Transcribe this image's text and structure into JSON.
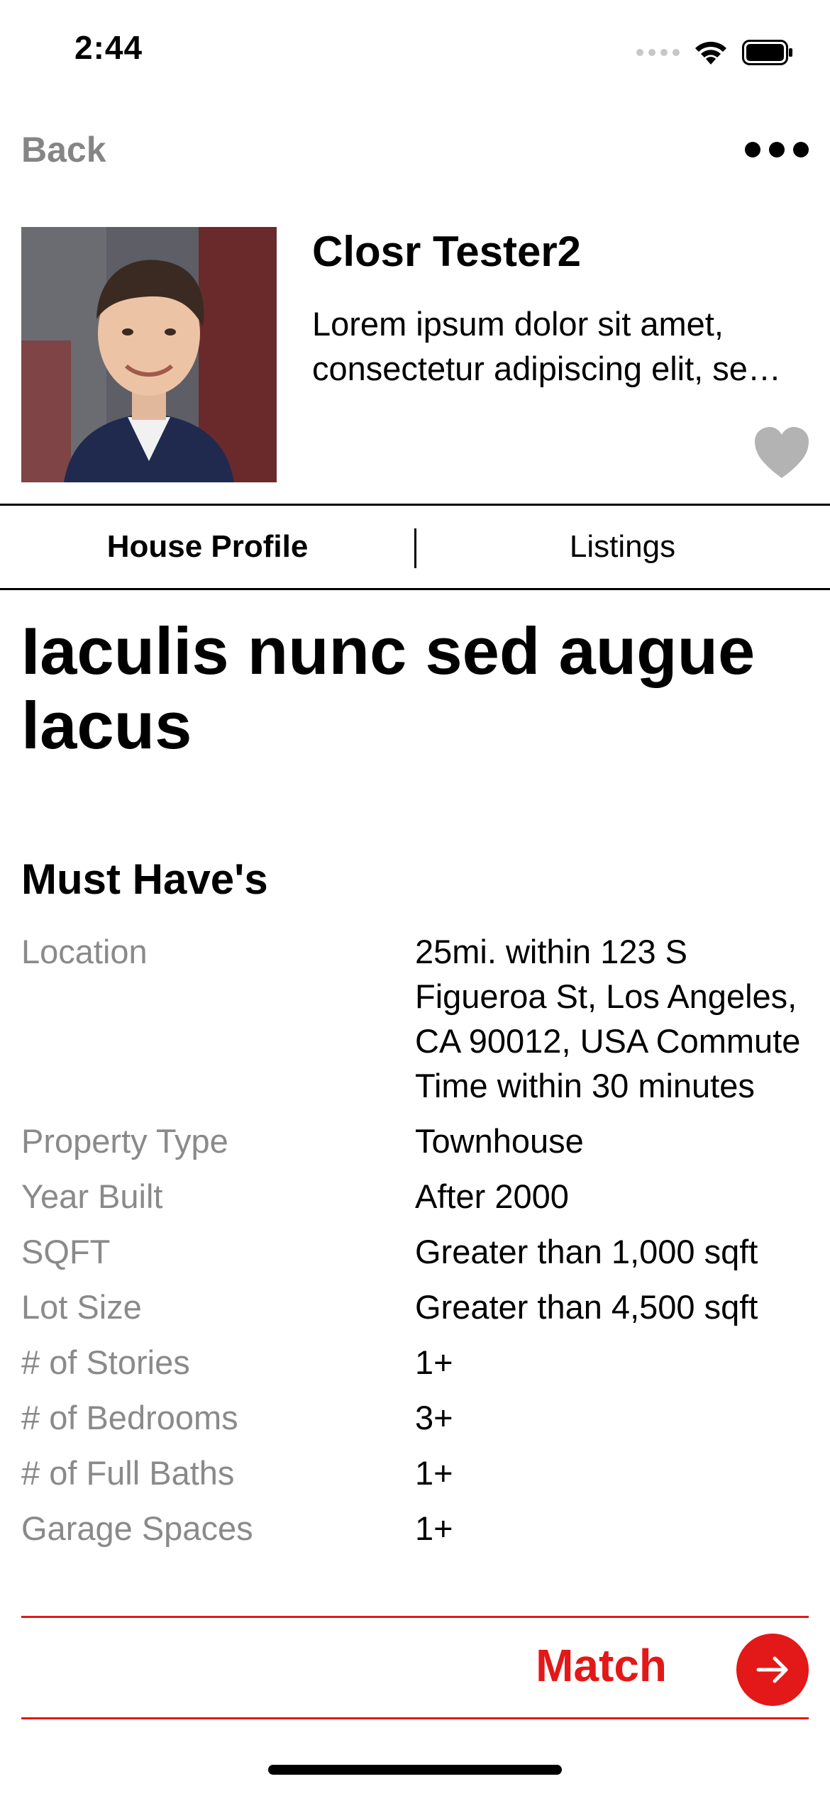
{
  "status_bar": {
    "time": "2:44"
  },
  "nav": {
    "back_label": "Back"
  },
  "profile": {
    "name": "Closr Tester2",
    "bio": "Lorem ipsum dolor sit amet, consectetur adipiscing elit, sed do eiusmod tempor incididunt ut labore"
  },
  "tabs": [
    {
      "label": "House Profile",
      "active": true
    },
    {
      "label": "Listings",
      "active": false
    }
  ],
  "headline": "Iaculis nunc sed augue lacus",
  "must_haves": {
    "title": "Must Have's",
    "rows": [
      {
        "label": "Location",
        "value": "25mi. within 123 S Figueroa St, Los Angeles, CA 90012, USA Commute Time within 30 minutes"
      },
      {
        "label": "Property Type",
        "value": "Townhouse"
      },
      {
        "label": "Year Built",
        "value": "After 2000"
      },
      {
        "label": "SQFT",
        "value": "Greater than 1,000 sqft"
      },
      {
        "label": "Lot Size",
        "value": "Greater than 4,500 sqft"
      },
      {
        "label": "# of Stories",
        "value": "1+"
      },
      {
        "label": "# of Bedrooms",
        "value": "3+"
      },
      {
        "label": "# of Full Baths",
        "value": "1+"
      },
      {
        "label": "Garage Spaces",
        "value": "1+"
      }
    ]
  },
  "match": {
    "label": "Match"
  },
  "colors": {
    "accent": "#e31818",
    "muted_text": "#8a8a8a",
    "heart": "#b3b3b3"
  }
}
